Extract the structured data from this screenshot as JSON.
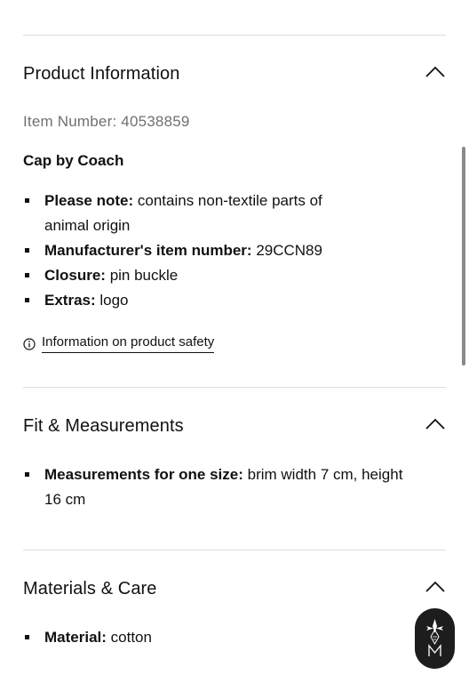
{
  "sections": {
    "product_information": {
      "title": "Product Information",
      "item_number": "Item Number: 40538859",
      "product_name": "Cap by Coach",
      "details": [
        {
          "label": "Please note:",
          "value": " contains non-textile parts of"
        },
        {
          "label": "Manufacturer's item number:",
          "value": " 29CCN89"
        },
        {
          "label": "Closure:",
          "value": " pin buckle"
        },
        {
          "label": "Extras:",
          "value": " logo"
        }
      ],
      "details_note_continuation": "animal origin",
      "safety_link": "Information on product safety"
    },
    "fit_measurements": {
      "title": "Fit & Measurements",
      "details": [
        {
          "label": "Measurements for one size:",
          "value": " brim width 7 cm, height"
        }
      ],
      "details_continuation": "16 cm"
    },
    "materials_care": {
      "title": "Materials & Care",
      "details": [
        {
          "label": "Material:",
          "value": " cotton"
        }
      ]
    }
  },
  "icons": {
    "section_toggle": "chevron-up-icon",
    "safety": "info-icon",
    "assistant": "assistant-logo-icon"
  },
  "colors": {
    "text": "#111111",
    "muted_text": "#707070",
    "divider": "#dcdcdc",
    "fab_background": "#1d1d1d"
  }
}
